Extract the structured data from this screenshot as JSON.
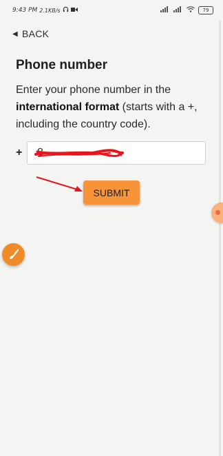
{
  "status_bar": {
    "time": "9:43 PM",
    "network_speed": "2.1KB/s",
    "battery": "79"
  },
  "nav": {
    "back_label": "BACK"
  },
  "page": {
    "title": "Phone number",
    "description_prefix": "Enter your phone number in the ",
    "description_bold": "international format",
    "description_suffix": " (starts with a +, including the country code)."
  },
  "form": {
    "country_prefix": "+",
    "phone_value": "8",
    "submit_label": "SUBMIT"
  },
  "colors": {
    "accent": "#f7943a",
    "background": "#f4f5f2",
    "annotation": "#e8141c"
  },
  "icons": {
    "back": "back-arrow-icon",
    "headphones": "headphones-icon",
    "video": "video-icon",
    "signal": "signal-icon",
    "wifi": "wifi-icon",
    "battery": "battery-icon",
    "edit": "paintbrush-icon"
  }
}
